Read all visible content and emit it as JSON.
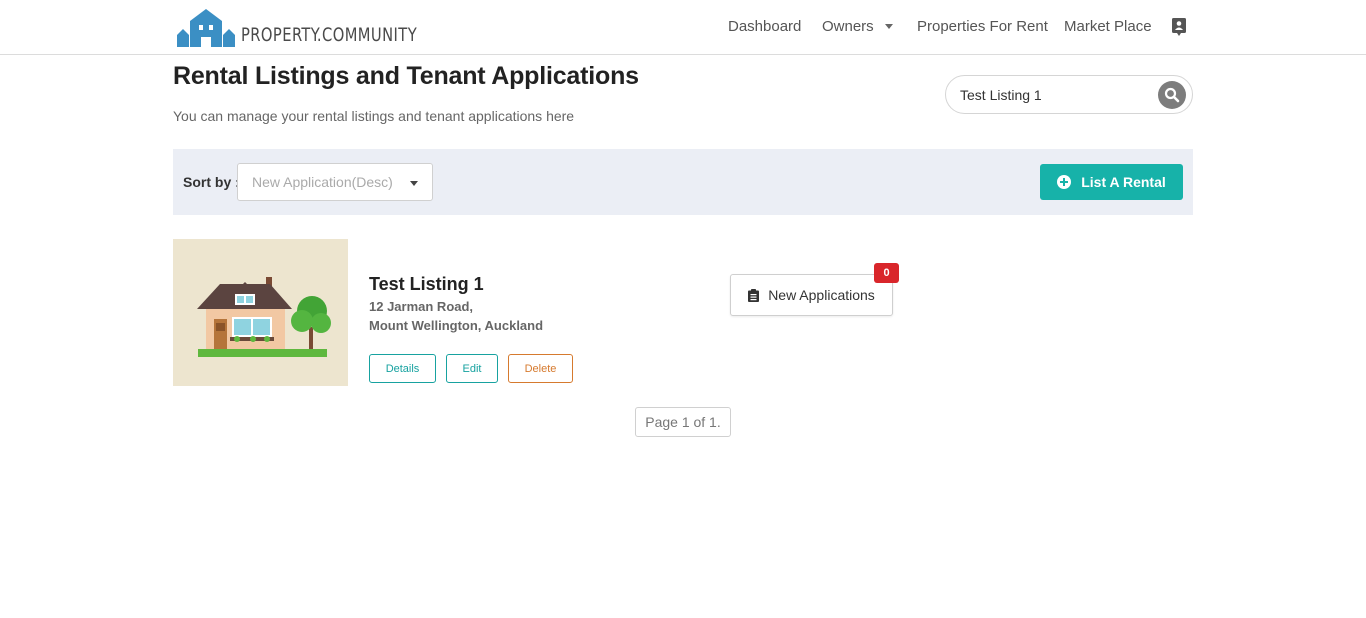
{
  "brand": {
    "name": "PROPERTY.COMMUNITY",
    "accent": "#17b2a9",
    "logo_color": "#3b8fc4"
  },
  "nav": {
    "items": [
      {
        "label": "Dashboard"
      },
      {
        "label": "Owners"
      },
      {
        "label": "Properties For Rent"
      },
      {
        "label": "Market Place"
      }
    ],
    "contact_icon": "contact-card-icon"
  },
  "page": {
    "title": "Rental Listings and Tenant Applications",
    "subtitle": "You can manage your rental listings and tenant applications here"
  },
  "search": {
    "value": "Test Listing 1",
    "icon": "search-icon"
  },
  "sort": {
    "label": "Sort by :",
    "selected": "New Application(Desc)"
  },
  "actions": {
    "list_rental": "List A Rental"
  },
  "listing": {
    "title": "Test Listing 1",
    "address_line1": "12 Jarman Road,",
    "address_line2": "Mount Wellington, Auckland",
    "details_label": "Details",
    "edit_label": "Edit",
    "delete_label": "Delete",
    "applications_label": "New Applications",
    "applications_count": "0"
  },
  "pagination": {
    "text": "Page 1 of 1."
  },
  "colors": {
    "delete": "#d67a2e",
    "badge": "#d9262b",
    "sortbar_bg": "#ebeef5"
  }
}
